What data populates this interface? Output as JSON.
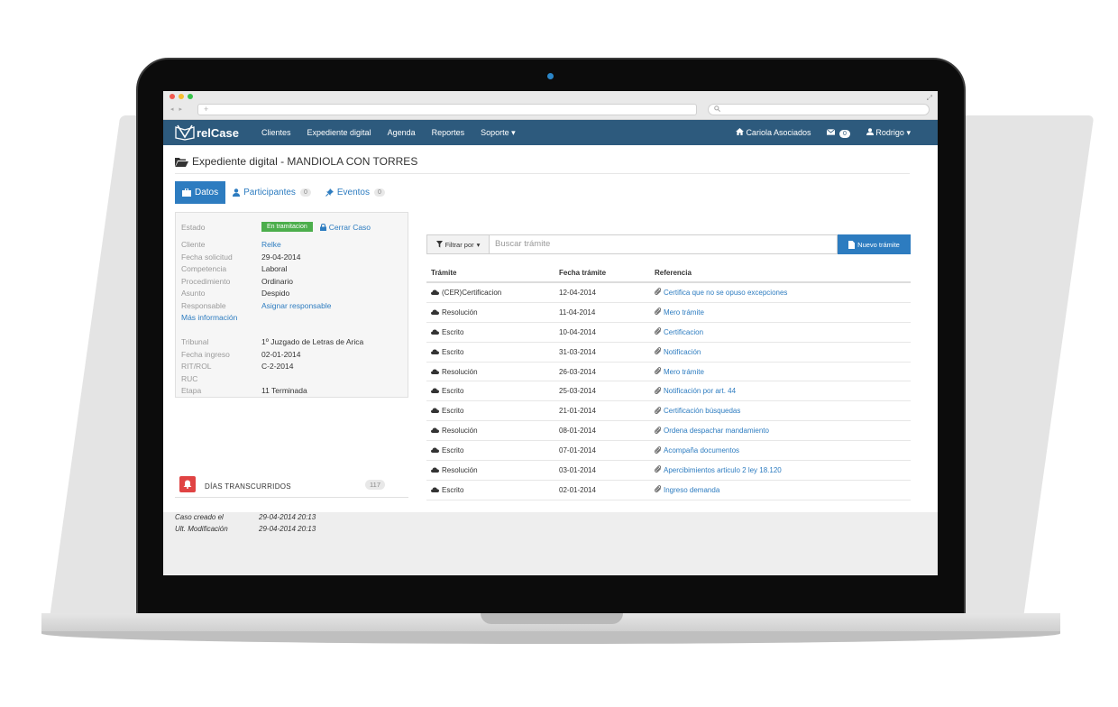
{
  "browser": {
    "url_placeholder": "+",
    "search_icon": "search-icon",
    "nav_glyphs": "◂ ▸"
  },
  "nav": {
    "logo_text": "relCase",
    "items": [
      "Clientes",
      "Expediente digital",
      "Agenda",
      "Reportes",
      "Soporte"
    ],
    "firm": "Cariola Asociados",
    "messages_count": "0",
    "user": "Rodrigo",
    "color": "#2d5a7d"
  },
  "page": {
    "title": "Expediente digital - MANDIOLA CON TORRES"
  },
  "tabs": [
    {
      "label": "Datos"
    },
    {
      "label": "Participantes",
      "count": "0"
    },
    {
      "label": "Eventos",
      "count": "0"
    }
  ],
  "details": {
    "estado_label": "Estado",
    "estado_value": "En tramitacion",
    "close_case": "Cerrar Caso",
    "fields": [
      {
        "k": "Cliente",
        "v": "Relke",
        "link": true
      },
      {
        "k": "Fecha solicitud",
        "v": "29-04-2014"
      },
      {
        "k": "Competencia",
        "v": "Laboral"
      },
      {
        "k": "Procedimiento",
        "v": "Ordinario"
      },
      {
        "k": "Asunto",
        "v": "Despido"
      },
      {
        "k": "Responsable",
        "v": "Asignar responsable",
        "link": true
      }
    ],
    "more_info": "Más información",
    "court_fields": [
      {
        "k": "Tribunal",
        "v": "1º Juzgado de Letras de Arica"
      },
      {
        "k": "Fecha ingreso",
        "v": "02-01-2014"
      },
      {
        "k": "RIT/ROL",
        "v": "C-2-2014"
      },
      {
        "k": "RUC",
        "v": ""
      },
      {
        "k": "Etapa",
        "v": "11 Terminada"
      }
    ]
  },
  "days": {
    "label": "DÍAS TRANSCURRIDOS",
    "count": "117"
  },
  "meta": [
    {
      "k": "Caso creado el",
      "v": "29-04-2014 20:13"
    },
    {
      "k": "Ult. Modificación",
      "v": "29-04-2014 20:13"
    }
  ],
  "toolbar": {
    "filter_label": "Filtrar por",
    "search_placeholder": "Buscar trámite",
    "new_label": "Nuevo trámite",
    "accent": "#2d7cc0"
  },
  "table": {
    "headers": [
      "Trámite",
      "Fecha trámite",
      "Referencia"
    ],
    "rows": [
      [
        "(CER)Certificacion",
        "12-04-2014",
        "Certifica que no se opuso excepciones"
      ],
      [
        "Resolución",
        "11-04-2014",
        "Mero trámite"
      ],
      [
        "Escrito",
        "10-04-2014",
        "Certificacion"
      ],
      [
        "Escrito",
        "31-03-2014",
        "Notificación"
      ],
      [
        "Resolución",
        "26-03-2014",
        "Mero trámite"
      ],
      [
        "Escrito",
        "25-03-2014",
        "Notificación por art. 44"
      ],
      [
        "Escrito",
        "21-01-2014",
        "Certificación búsquedas"
      ],
      [
        "Resolución",
        "08-01-2014",
        "Ordena despachar mandamiento"
      ],
      [
        "Escrito",
        "07-01-2014",
        "Acompaña documentos"
      ],
      [
        "Resolución",
        "03-01-2014",
        "Apercibimientos articulo 2 ley 18.120"
      ],
      [
        "Escrito",
        "02-01-2014",
        "Ingreso demanda"
      ]
    ]
  }
}
